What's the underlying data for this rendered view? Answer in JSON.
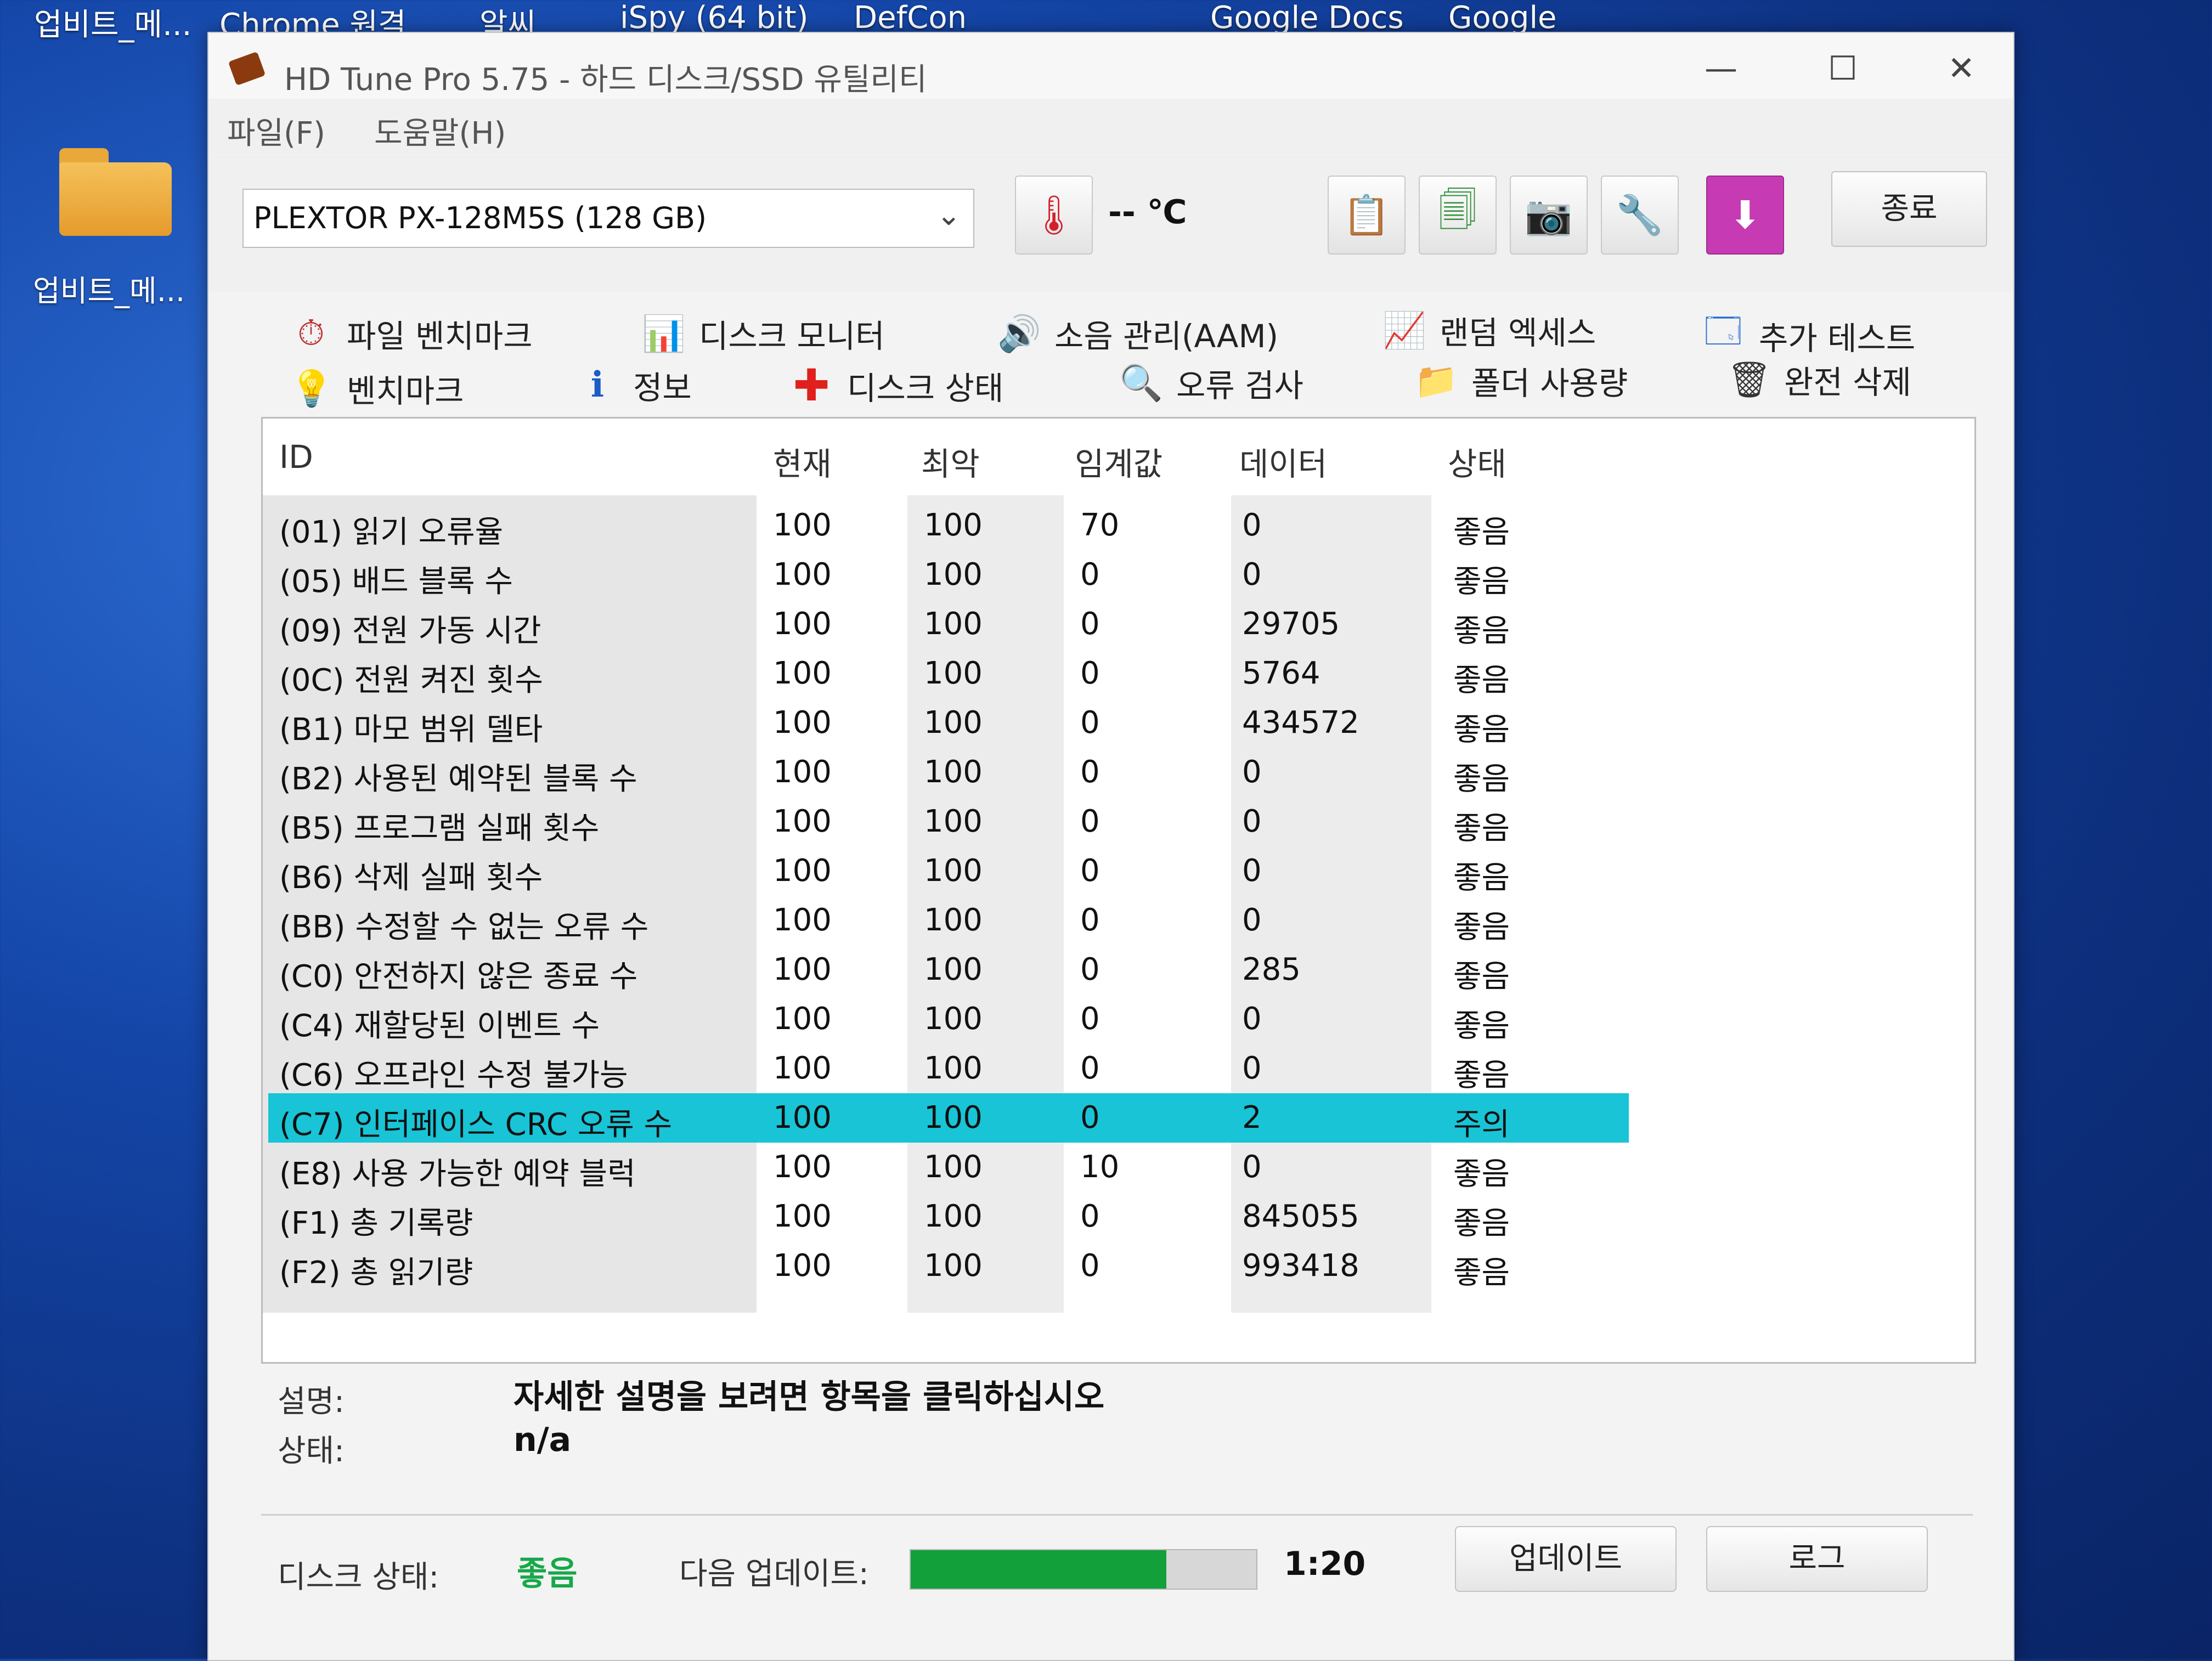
{
  "desktop": {
    "top_labels": [
      "업비트_메...",
      "Chrome 원격",
      "알씨",
      "iSpy (64 bit)",
      "DefCon",
      "Google Docs",
      "Google"
    ],
    "folder_label": "업비트_메..."
  },
  "window": {
    "title": "HD Tune Pro 5.75 - 하드 디스크/SSD 유틸리티",
    "minimize": "—",
    "maximize": "☐",
    "close": "✕"
  },
  "menu": {
    "file": "파일(F)",
    "help": "도움말(H)"
  },
  "toolbar": {
    "drive": "PLEXTOR PX-128M5S (128 GB)",
    "temperature": "-- ℃",
    "exit_label": "종료"
  },
  "tabs_row1": [
    {
      "label": "파일 벤치마크",
      "icon": "file-benchmark-icon"
    },
    {
      "label": "디스크 모니터",
      "icon": "disk-monitor-icon"
    },
    {
      "label": "소음 관리(AAM)",
      "icon": "speaker-icon"
    },
    {
      "label": "랜덤 엑세스",
      "icon": "random-access-icon"
    },
    {
      "label": "추가 테스트",
      "icon": "extra-test-icon"
    }
  ],
  "tabs_row2": [
    {
      "label": "벤치마크",
      "icon": "benchmark-icon"
    },
    {
      "label": "정보",
      "icon": "info-icon"
    },
    {
      "label": "디스크 상태",
      "icon": "health-cross-icon"
    },
    {
      "label": "오류 검사",
      "icon": "magnifier-icon"
    },
    {
      "label": "폴더 사용량",
      "icon": "folder-icon"
    },
    {
      "label": "완전 삭제",
      "icon": "trash-icon"
    }
  ],
  "table": {
    "headers": [
      "ID",
      "현재",
      "최악",
      "임계값",
      "데이터",
      "상태"
    ],
    "rows": [
      [
        "(01) 읽기 오류율",
        "100",
        "100",
        "70",
        "0",
        "좋음"
      ],
      [
        "(05) 배드 블록 수",
        "100",
        "100",
        "0",
        "0",
        "좋음"
      ],
      [
        "(09) 전원 가동 시간",
        "100",
        "100",
        "0",
        "29705",
        "좋음"
      ],
      [
        "(0C) 전원 켜진 횟수",
        "100",
        "100",
        "0",
        "5764",
        "좋음"
      ],
      [
        "(B1) 마모 범위 델타",
        "100",
        "100",
        "0",
        "434572",
        "좋음"
      ],
      [
        "(B2) 사용된 예약된 블록 수",
        "100",
        "100",
        "0",
        "0",
        "좋음"
      ],
      [
        "(B5) 프로그램 실패 횟수",
        "100",
        "100",
        "0",
        "0",
        "좋음"
      ],
      [
        "(B6) 삭제 실패 횟수",
        "100",
        "100",
        "0",
        "0",
        "좋음"
      ],
      [
        "(BB) 수정할 수 없는 오류 수",
        "100",
        "100",
        "0",
        "0",
        "좋음"
      ],
      [
        "(C0) 안전하지 않은 종료 수",
        "100",
        "100",
        "0",
        "285",
        "좋음"
      ],
      [
        "(C4) 재할당된 이벤트 수",
        "100",
        "100",
        "0",
        "0",
        "좋음"
      ],
      [
        "(C6) 오프라인 수정 불가능",
        "100",
        "100",
        "0",
        "0",
        "좋음"
      ],
      [
        "(C7) 인터페이스 CRC 오류 수",
        "100",
        "100",
        "0",
        "2",
        "주의"
      ],
      [
        "(E8) 사용 가능한 예약 블럭",
        "100",
        "100",
        "10",
        "0",
        "좋음"
      ],
      [
        "(F1) 총 기록량",
        "100",
        "100",
        "0",
        "845055",
        "좋음"
      ],
      [
        "(F2) 총 읽기량",
        "100",
        "100",
        "0",
        "993418",
        "좋음"
      ]
    ],
    "selected_row": 12,
    "selected_color": "#18c4d6"
  },
  "info": {
    "desc_label": "설명:",
    "desc_value": "자세한 설명을 보려면 항목을 클릭하십시오",
    "status_label": "상태:",
    "status_value": "n/a"
  },
  "footer": {
    "disk_status_label": "디스크 상태:",
    "disk_status_value": "좋음",
    "disk_status_color": "#17a84a",
    "next_update_label": "다음 업데이트:",
    "next_update_progress": 0.74,
    "next_update_time": "1:20",
    "update_button": "업데이트",
    "log_button": "로그"
  }
}
